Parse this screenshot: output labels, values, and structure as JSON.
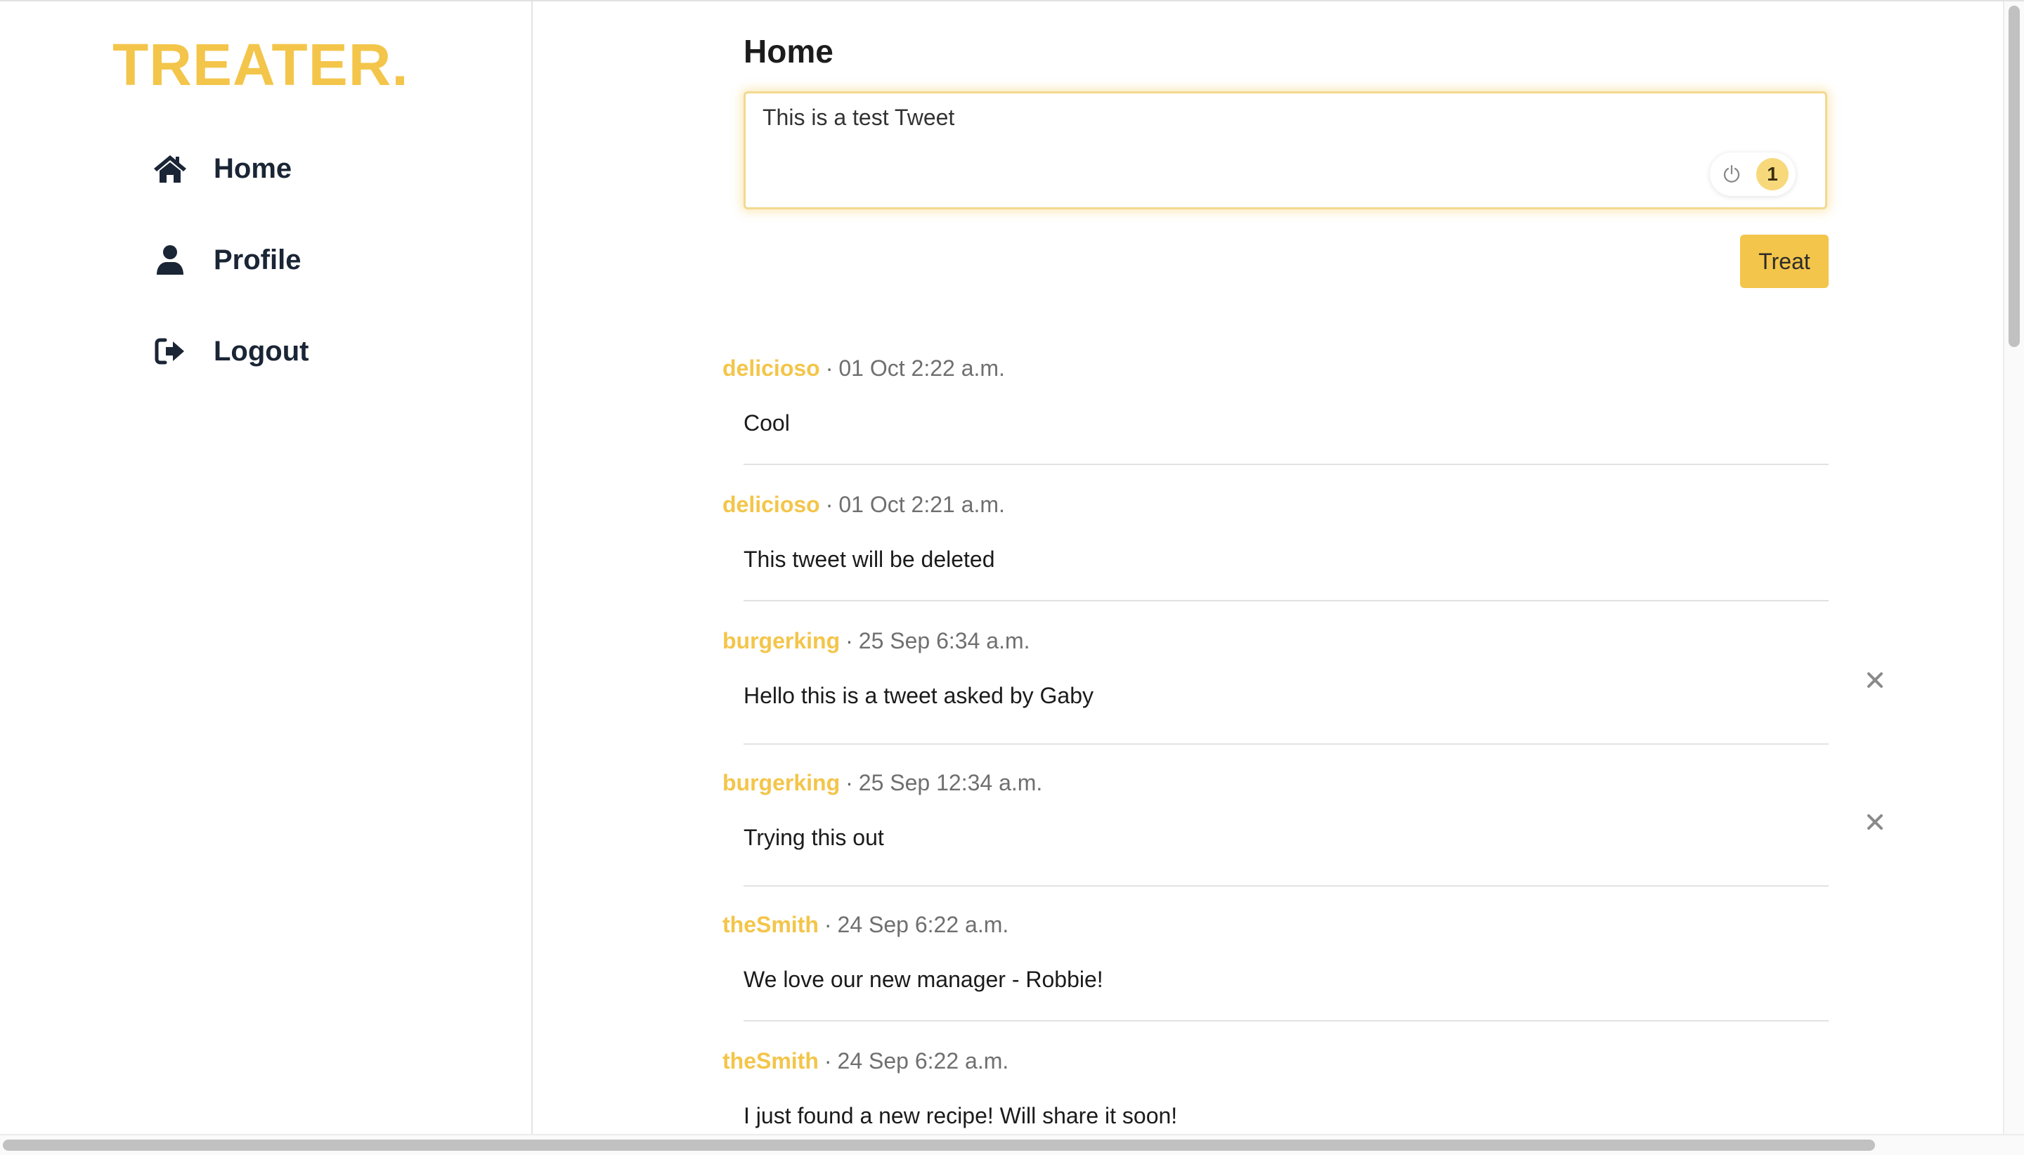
{
  "app": {
    "logo": "TREATER.",
    "accent_color": "#f3c54a",
    "text_color": "#1a2535"
  },
  "sidebar": {
    "items": [
      {
        "label": "Home",
        "icon": "home-icon"
      },
      {
        "label": "Profile",
        "icon": "user-icon"
      },
      {
        "label": "Logout",
        "icon": "sign-out-icon"
      }
    ]
  },
  "main": {
    "title": "Home",
    "composer": {
      "value": "This is a test Tweet",
      "count": "1",
      "tool_icon": "power-icon"
    },
    "treat_label": "Treat",
    "meta_separator": "·",
    "tweets": [
      {
        "author": "delicioso",
        "date": "01 Oct 2:22 a.m.",
        "text": "Cool",
        "deletable": false
      },
      {
        "author": "delicioso",
        "date": "01 Oct 2:21 a.m.",
        "text": "This tweet will be deleted",
        "deletable": false
      },
      {
        "author": "burgerking",
        "date": "25 Sep 6:34 a.m.",
        "text": "Hello this is a tweet asked by Gaby",
        "deletable": true
      },
      {
        "author": "burgerking",
        "date": "25 Sep 12:34 a.m.",
        "text": "Trying this out",
        "deletable": true
      },
      {
        "author": "theSmith",
        "date": "24 Sep 6:22 a.m.",
        "text": "We love our new manager - Robbie!",
        "deletable": false
      },
      {
        "author": "theSmith",
        "date": "24 Sep 6:22 a.m.",
        "text": "I just found a new recipe! Will share it soon!",
        "deletable": false
      }
    ]
  }
}
